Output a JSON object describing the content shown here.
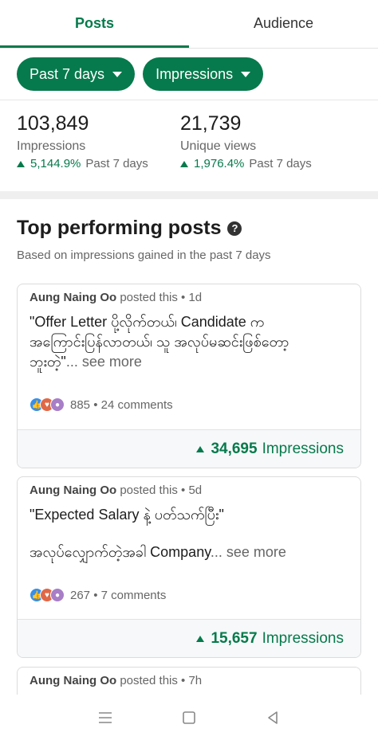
{
  "tabs": [
    {
      "label": "Posts",
      "active": true
    },
    {
      "label": "Audience",
      "active": false
    }
  ],
  "filters": {
    "period_label": "Past 7 days",
    "metric_label": "Impressions"
  },
  "stats": [
    {
      "value": "103,849",
      "label": "Impressions",
      "change": "5,144.9%",
      "period": "Past 7 days"
    },
    {
      "value": "21,739",
      "label": "Unique views",
      "change": "1,976.4%",
      "period": "Past 7 days"
    }
  ],
  "top_posts": {
    "title": "Top performing posts",
    "help_icon": "question-icon",
    "subtitle": "Based on impressions gained in the past 7 days",
    "posts": [
      {
        "author": "Aung Naing Oo",
        "meta": "posted this • 1d",
        "line1": "\"Offer Letter ပို့လိုက်တယ်၊ Candidate က",
        "line2": "အကြောင်းပြန်လာတယ်၊ သူ အလုပ်မဆင်းဖြစ်တော့",
        "line3": "ဘူးတဲ့\"",
        "see_more": "... see more",
        "reactions": "885",
        "comments": "24 comments",
        "impressions_value": "34,695",
        "impressions_label": "Impressions"
      },
      {
        "author": "Aung Naing Oo",
        "meta": "posted this • 5d",
        "line1": "\"Expected Salary နဲ့ ပတ်သက်ပြီး\"",
        "line2": "အလုပ်လျှောက်တဲ့အခါ Company",
        "see_more": "... see more",
        "reactions": "267",
        "comments": "7 comments",
        "impressions_value": "15,657",
        "impressions_label": "Impressions"
      },
      {
        "author": "Aung Naing Oo",
        "meta": "posted this • 7h"
      }
    ]
  },
  "navbar": {
    "icons": [
      "menu-icon",
      "home-square-icon",
      "back-triangle-icon"
    ]
  },
  "colors": {
    "accent": "#067a4c",
    "muted": "#666666",
    "separator": "#efefef"
  }
}
